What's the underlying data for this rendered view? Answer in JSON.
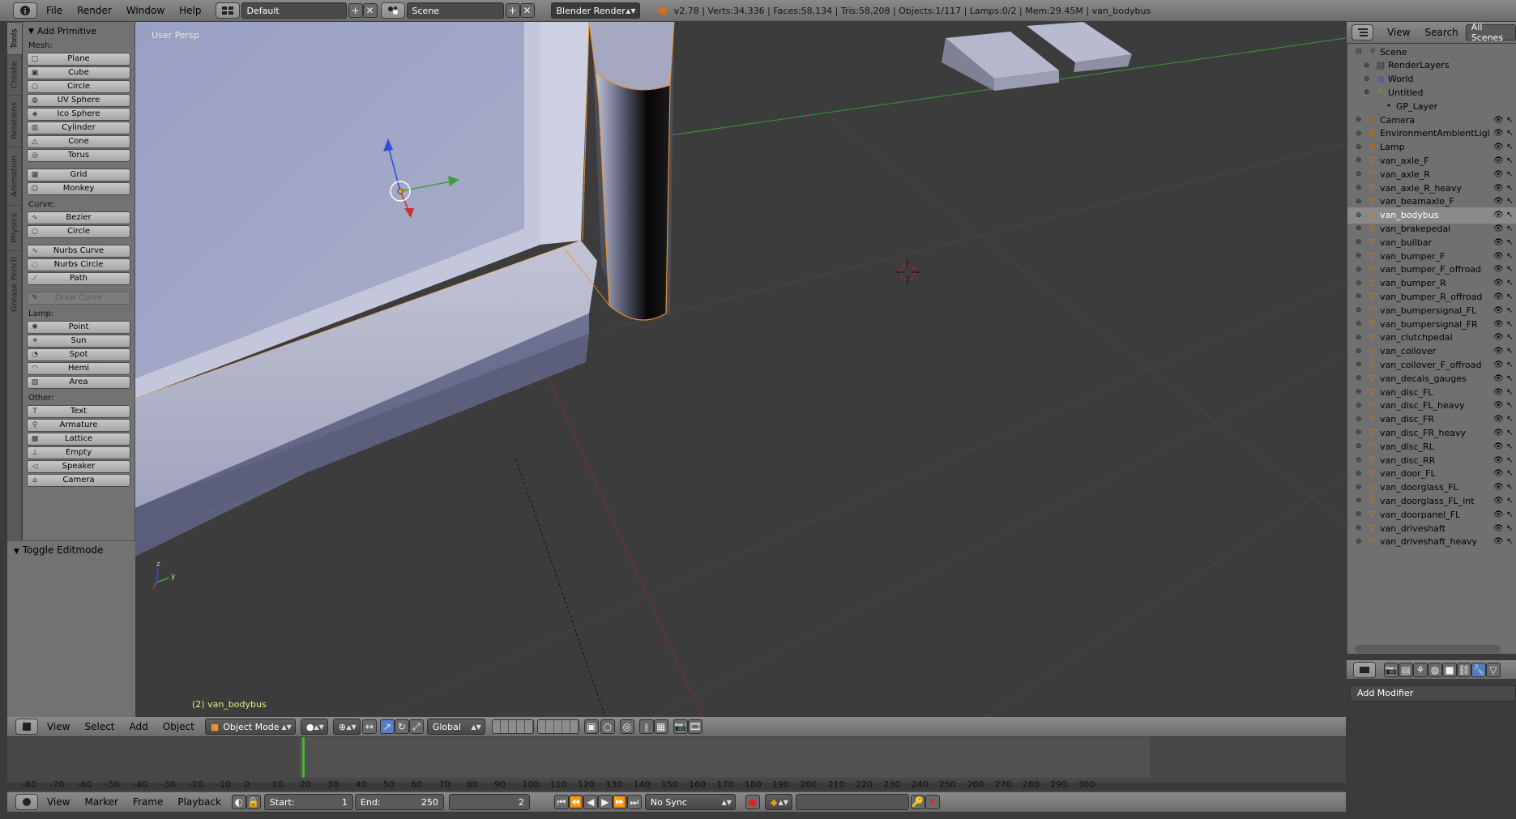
{
  "info_bar": {
    "menus": [
      "File",
      "Render",
      "Window",
      "Help"
    ],
    "screen_layout": "Default",
    "scene": "Scene",
    "engine": "Blender Render",
    "stats": "v2.78 | Verts:34,336 | Faces:58,134 | Tris:58,208 | Objects:1/117 | Lamps:0/2 | Mem:29.45M | van_bodybus"
  },
  "tool_tabs": [
    "Tools",
    "Create",
    "Relations",
    "Animation",
    "Physics",
    "Grease Pencil"
  ],
  "shelf": {
    "title": "Add Primitive",
    "groups": [
      {
        "label": "Mesh:",
        "items": [
          "Plane",
          "Cube",
          "Circle",
          "UV Sphere",
          "Ico Sphere",
          "Cylinder",
          "Cone",
          "Torus"
        ]
      },
      {
        "label": "",
        "items": [
          "Grid",
          "Monkey"
        ]
      },
      {
        "label": "Curve:",
        "items": [
          "Bezier",
          "Circle"
        ]
      },
      {
        "label": "",
        "items": [
          "Nurbs Curve",
          "Nurbs Circle",
          "Path"
        ]
      },
      {
        "label": "",
        "items": [
          "Draw Curve"
        ]
      },
      {
        "label": "Lamp:",
        "items": [
          "Point",
          "Sun",
          "Spot",
          "Hemi",
          "Area"
        ]
      },
      {
        "label": "Other:",
        "items": [
          "Text",
          "Armature",
          "Lattice",
          "Empty",
          "Speaker",
          "Camera"
        ]
      }
    ],
    "toggle_panel": "Toggle Editmode"
  },
  "viewport": {
    "view_label": "User Persp",
    "object_label": "(2) van_bodybus"
  },
  "view3d_header": {
    "menus": [
      "View",
      "Select",
      "Add",
      "Object"
    ],
    "mode": "Object Mode",
    "orientation": "Global"
  },
  "timeline": {
    "ruler": [
      "-80",
      "-70",
      "-60",
      "-50",
      "-40",
      "-30",
      "-20",
      "-10",
      "0",
      "10",
      "20",
      "30",
      "40",
      "50",
      "60",
      "70",
      "80",
      "90",
      "100",
      "110",
      "120",
      "130",
      "140",
      "150",
      "160",
      "170",
      "180",
      "190",
      "200",
      "210",
      "220",
      "230",
      "240",
      "250",
      "260",
      "270",
      "280",
      "290",
      "300"
    ],
    "current_frame": "2",
    "start_label": "Start:",
    "start": "1",
    "end_label": "End:",
    "end": "250",
    "sync": "No Sync",
    "menus": [
      "View",
      "Marker",
      "Frame",
      "Playback"
    ]
  },
  "outliner": {
    "header": {
      "view": "View",
      "search": "Search",
      "filter": "All Scenes"
    },
    "items": [
      {
        "name": "Scene",
        "indent": 0,
        "icon": "scene"
      },
      {
        "name": "RenderLayers",
        "indent": 1,
        "icon": "renderlayers"
      },
      {
        "name": "World",
        "indent": 1,
        "icon": "world"
      },
      {
        "name": "Untitled",
        "indent": 1,
        "icon": "grease-pencil"
      },
      {
        "name": "GP_Layer",
        "indent": 2,
        "icon": "dot"
      },
      {
        "name": "Camera",
        "indent": 0,
        "icon": "camera"
      },
      {
        "name": "EnvironmentAmbientLigl",
        "indent": 0,
        "icon": "lamp"
      },
      {
        "name": "Lamp",
        "indent": 0,
        "icon": "lamp"
      },
      {
        "name": "van_axle_F",
        "indent": 0,
        "icon": "mesh"
      },
      {
        "name": "van_axle_R",
        "indent": 0,
        "icon": "mesh"
      },
      {
        "name": "van_axle_R_heavy",
        "indent": 0,
        "icon": "mesh"
      },
      {
        "name": "van_beamaxle_F",
        "indent": 0,
        "icon": "mesh"
      },
      {
        "name": "van_bodybus",
        "indent": 0,
        "icon": "mesh",
        "selected": true
      },
      {
        "name": "van_brakepedal",
        "indent": 0,
        "icon": "mesh"
      },
      {
        "name": "van_bullbar",
        "indent": 0,
        "icon": "mesh"
      },
      {
        "name": "van_bumper_F",
        "indent": 0,
        "icon": "mesh"
      },
      {
        "name": "van_bumper_F_offroad",
        "indent": 0,
        "icon": "mesh"
      },
      {
        "name": "van_bumper_R",
        "indent": 0,
        "icon": "mesh"
      },
      {
        "name": "van_bumper_R_offroad",
        "indent": 0,
        "icon": "mesh"
      },
      {
        "name": "van_bumpersignal_FL",
        "indent": 0,
        "icon": "mesh"
      },
      {
        "name": "van_bumpersignal_FR",
        "indent": 0,
        "icon": "mesh"
      },
      {
        "name": "van_clutchpedal",
        "indent": 0,
        "icon": "mesh"
      },
      {
        "name": "van_coilover",
        "indent": 0,
        "icon": "mesh"
      },
      {
        "name": "van_coilover_F_offroad",
        "indent": 0,
        "icon": "mesh"
      },
      {
        "name": "van_decals_gauges",
        "indent": 0,
        "icon": "mesh"
      },
      {
        "name": "van_disc_FL",
        "indent": 0,
        "icon": "mesh"
      },
      {
        "name": "van_disc_FL_heavy",
        "indent": 0,
        "icon": "mesh"
      },
      {
        "name": "van_disc_FR",
        "indent": 0,
        "icon": "mesh"
      },
      {
        "name": "van_disc_FR_heavy",
        "indent": 0,
        "icon": "mesh"
      },
      {
        "name": "van_disc_RL",
        "indent": 0,
        "icon": "mesh"
      },
      {
        "name": "van_disc_RR",
        "indent": 0,
        "icon": "mesh"
      },
      {
        "name": "van_door_FL",
        "indent": 0,
        "icon": "mesh"
      },
      {
        "name": "van_doorglass_FL",
        "indent": 0,
        "icon": "mesh"
      },
      {
        "name": "van_doorglass_FL_int",
        "indent": 0,
        "icon": "mesh"
      },
      {
        "name": "van_doorpanel_FL",
        "indent": 0,
        "icon": "mesh"
      },
      {
        "name": "van_driveshaft",
        "indent": 0,
        "icon": "mesh"
      },
      {
        "name": "van_driveshaft_heavy",
        "indent": 0,
        "icon": "mesh"
      }
    ]
  },
  "properties": {
    "add_modifier": "Add Modifier"
  },
  "colors": {
    "accent": "#e58a18",
    "selection": "#f5a623",
    "x_axis": "#c83232",
    "y_axis": "#3ca03c",
    "z_axis": "#2a50d8"
  }
}
